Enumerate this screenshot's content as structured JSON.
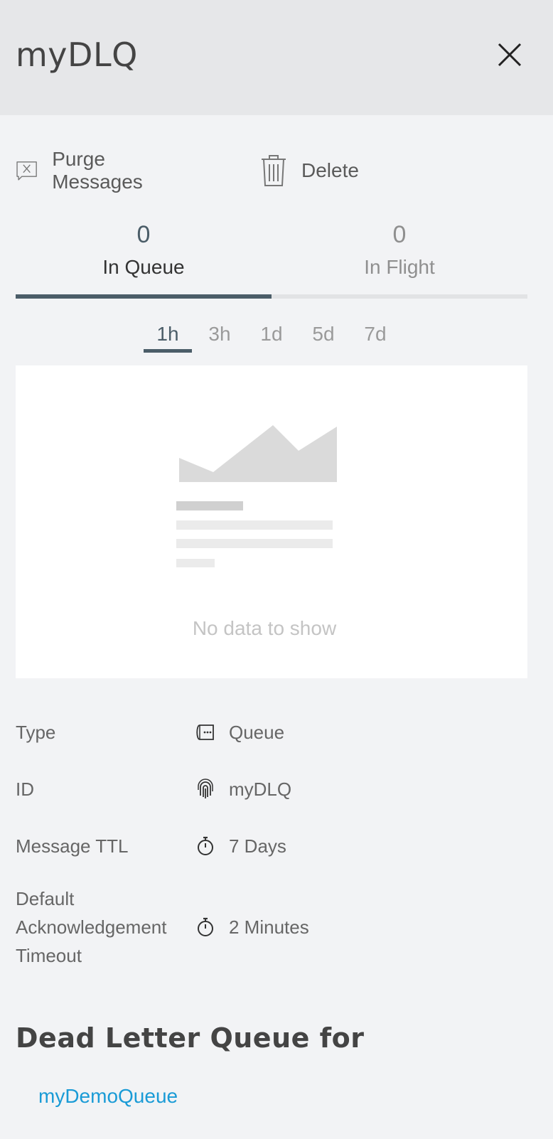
{
  "panel": {
    "title": "myDLQ"
  },
  "actions": {
    "purge_label": "Purge Messages",
    "delete_label": "Delete"
  },
  "tabs": [
    {
      "count": "0",
      "label": "In Queue",
      "active": true
    },
    {
      "count": "0",
      "label": "In Flight",
      "active": false
    }
  ],
  "time_ranges": {
    "items": [
      "1h",
      "3h",
      "1d",
      "5d",
      "7d"
    ],
    "selected": "1h"
  },
  "chart": {
    "empty_message": "No data to show"
  },
  "properties": [
    {
      "key": "Type",
      "icon": "queue-icon",
      "value": "Queue"
    },
    {
      "key": "ID",
      "icon": "fingerprint-icon",
      "value": "myDLQ"
    },
    {
      "key": "Message TTL",
      "icon": "stopwatch-icon",
      "value": "7 Days"
    },
    {
      "key_lines": [
        "Default",
        "Acknowledgement",
        "Timeout"
      ],
      "icon": "stopwatch-icon",
      "value": "2 Minutes"
    }
  ],
  "dead_letter": {
    "heading": "Dead Letter Queue for",
    "link": "myDemoQueue"
  },
  "colors": {
    "accent": "#4b5d68",
    "link": "#1a9bd6",
    "header_bg": "#e6e7e9",
    "page_bg": "#f2f3f5"
  }
}
